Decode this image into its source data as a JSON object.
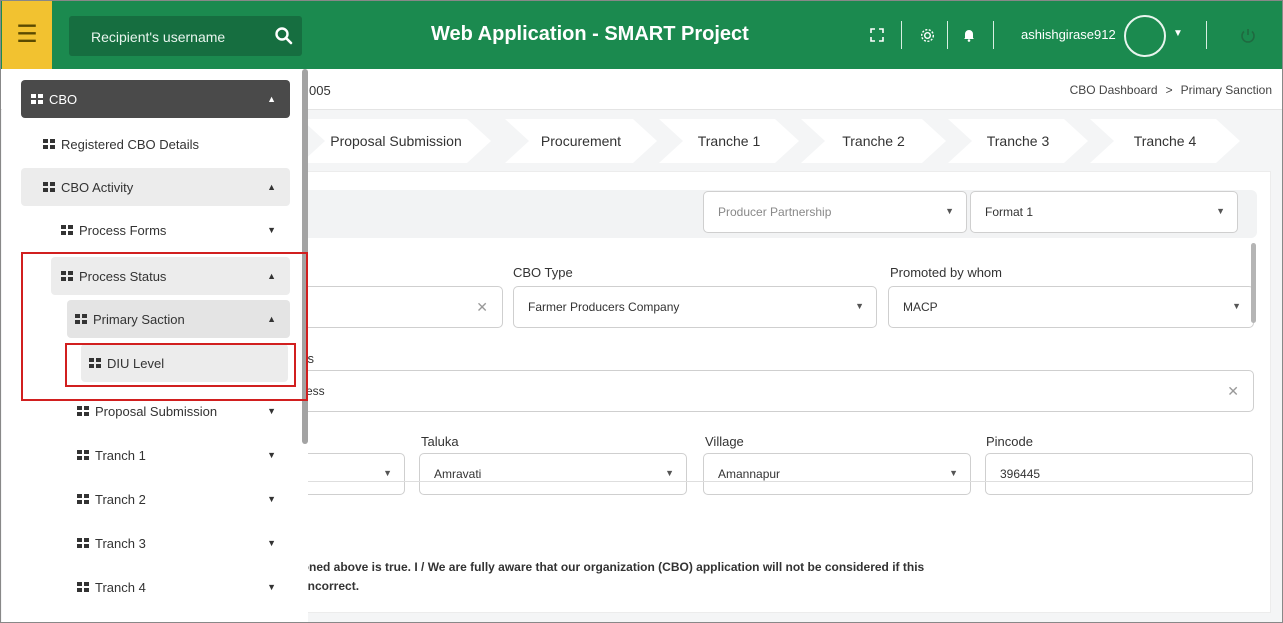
{
  "header": {
    "search_placeholder": "Recipient's username",
    "app_title": "Web Application - SMART Project",
    "username": "ashishgirase912"
  },
  "subbar": {
    "page_id_fragment": "005",
    "breadcrumb": [
      "CBO Dashboard",
      "Primary Sanction"
    ],
    "breadcrumb_sep": ">"
  },
  "steps": [
    "Proposal Submission",
    "Procurement",
    "Tranche 1",
    "Tranche 2",
    "Tranche 3",
    "Tranche 4"
  ],
  "form": {
    "producer_select": "Producer Partnership",
    "format_select": "Format 1",
    "cbo_type_label": "CBO Type",
    "cbo_type_value": "Farmer Producers Company",
    "promoted_label": "Promoted by whom",
    "promoted_value": "MACP",
    "address_label_fragment": "ss",
    "address_value_fragment": "ess",
    "taluka_label": "Taluka",
    "taluka_value": "Amravati",
    "village_label": "Village",
    "village_value": "Amannapur",
    "pincode_label": "Pincode",
    "pincode_value": "396445",
    "declaration_line1": "ntioned above is true. I / We are fully aware that our organization (CBO) application will not be considered if this",
    "declaration_line2": "be incorrect."
  },
  "sidebar": {
    "items": [
      {
        "label": "CBO",
        "caret": "▲"
      },
      {
        "label": "Registered CBO Details",
        "caret": ""
      },
      {
        "label": "CBO Activity",
        "caret": "▲"
      },
      {
        "label": "Process Forms",
        "caret": "▼"
      },
      {
        "label": "Process Status",
        "caret": "▲"
      },
      {
        "label": "Primary Saction",
        "caret": "▲"
      },
      {
        "label": "DIU Level",
        "caret": ""
      },
      {
        "label": "Proposal Submission",
        "caret": "▼"
      },
      {
        "label": "Tranch 1",
        "caret": "▼"
      },
      {
        "label": "Tranch 2",
        "caret": "▼"
      },
      {
        "label": "Tranch 3",
        "caret": "▼"
      },
      {
        "label": "Tranch 4",
        "caret": "▼"
      }
    ]
  },
  "colors": {
    "header_green": "#1b8a4f",
    "menu_yellow": "#f2c230",
    "highlight_red": "#d11f1f"
  }
}
